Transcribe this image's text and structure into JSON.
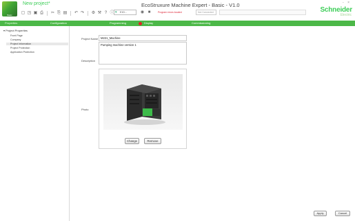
{
  "window": {
    "project_name": "New project*",
    "title": "EcoStruxure Machine Expert - Basic - V1.0",
    "controls": "- ×"
  },
  "app_icon_label": "Basic",
  "brand": {
    "name": "Schneider",
    "sub": "Electric",
    "color": "#3dcd58"
  },
  "toolbar": {
    "controller_select": "EIO...",
    "status_warning": "Program errors located",
    "status_pill": "Not Connected"
  },
  "tabs": [
    {
      "label": "Properties",
      "active": true
    },
    {
      "label": "Configuration",
      "active": false
    },
    {
      "label": "Programming",
      "active": false
    },
    {
      "label": "Display",
      "active": false,
      "alert": true
    },
    {
      "label": "Commissioning",
      "active": false
    }
  ],
  "nav": {
    "root": "Project Properties",
    "items": [
      {
        "label": "Front Page",
        "selected": false
      },
      {
        "label": "Company",
        "selected": false
      },
      {
        "label": "Project Information",
        "selected": true
      },
      {
        "label": "Project Protection",
        "selected": false
      },
      {
        "label": "Application Protection",
        "selected": false
      }
    ]
  },
  "form": {
    "project_name_label": "Project Name",
    "project_name_value": "M221_Machine",
    "description_label": "Description",
    "description_value": "Pumping machine version 1",
    "photo_label": "Photo",
    "change_button": "Change",
    "remove_button": "Remove"
  },
  "footer": {
    "apply": "Apply",
    "cancel": "Cancel"
  },
  "colors": {
    "accent_green": "#4cb848",
    "alert_red": "#e02424"
  }
}
